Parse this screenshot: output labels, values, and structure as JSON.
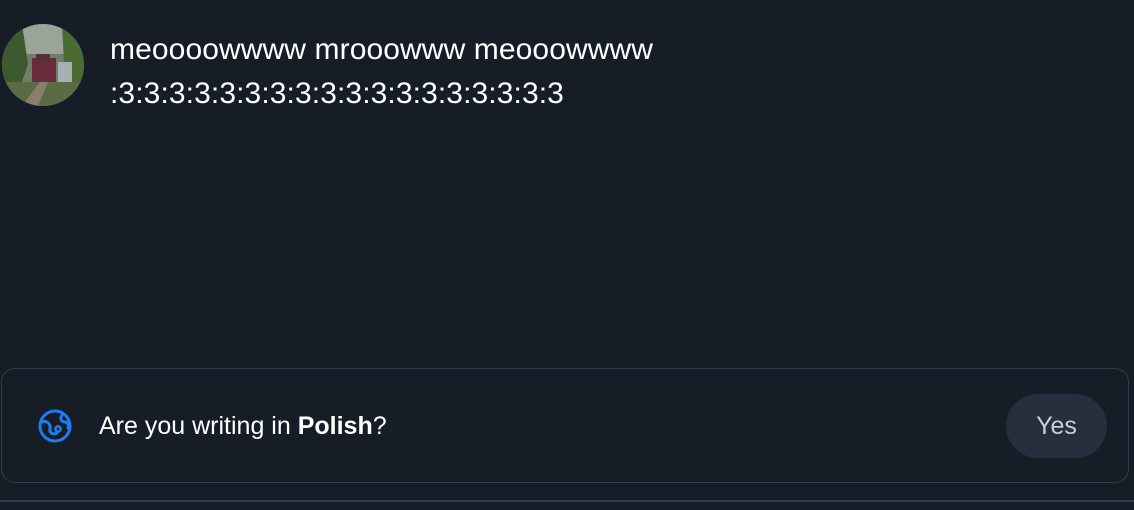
{
  "post": {
    "line1": "meoooowwww mrooowww meooowwww",
    "line2": ":3:3:3:3:3:3:3:3:3:3:3:3:3:3:3:3:3:3"
  },
  "language_prompt": {
    "prefix": "Are you writing in ",
    "language": "Polish",
    "suffix": "?",
    "icon": "translate-globe-icon",
    "yes_label": "Yes"
  },
  "colors": {
    "background": "#161d27",
    "accent": "#1d7cf2",
    "button_bg": "#262f3e",
    "border": "#323c4b"
  }
}
